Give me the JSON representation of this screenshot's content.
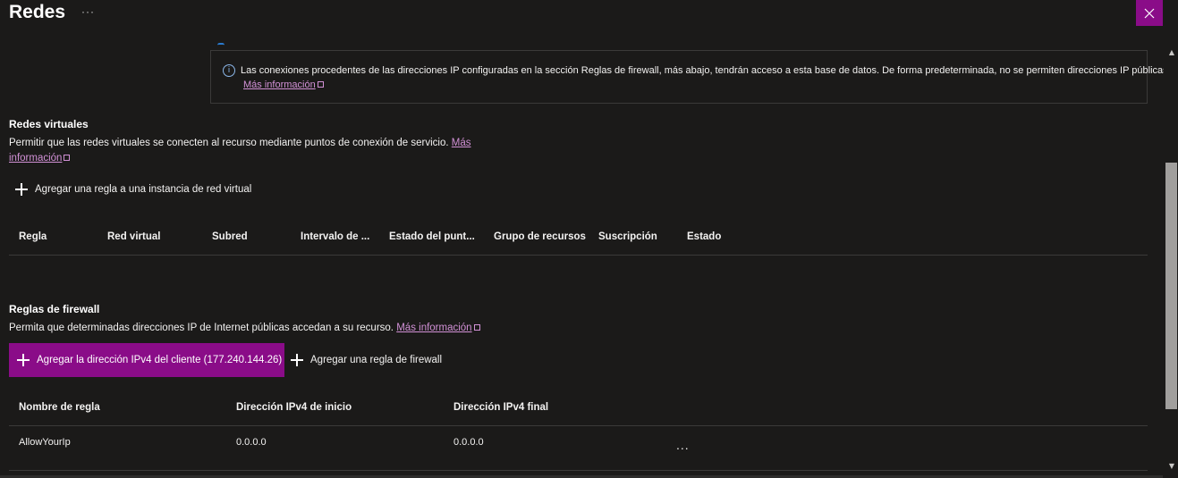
{
  "header": {
    "title": "Redes",
    "more": "···"
  },
  "info": {
    "icon": "info-icon",
    "text": "Las conexiones procedentes de las direcciones IP configuradas en la sección Reglas de firewall, más abajo, tendrán acceso a esta base de datos. De forma predeterminada, no se permiten direcciones IP públicas.",
    "link": "Más información"
  },
  "virtual_networks": {
    "heading": "Redes virtuales",
    "description": "Permitir que las redes virtuales se conecten al recurso mediante puntos de conexión de servicio.",
    "link_part1": "Más",
    "link_part2": "información",
    "add_rule": "Agregar una regla a una instancia de red virtual",
    "columns": [
      "Regla",
      "Red virtual",
      "Subred",
      "Intervalo de ...",
      "Estado del punt...",
      "Grupo de recursos",
      "Suscripción",
      "Estado"
    ]
  },
  "firewall": {
    "heading": "Reglas de firewall",
    "description": "Permita que determinadas direcciones IP de Internet públicas accedan a su recurso.",
    "link": "Más información",
    "add_client_ip": "Agregar la dirección IPv4 del cliente (177.240.144.26)",
    "add_rule": "Agregar una regla de firewall",
    "columns": [
      "Nombre de regla",
      "Dirección IPv4 de inicio",
      "Dirección IPv4 final"
    ],
    "rows": [
      {
        "name": "AllowYourIp",
        "start": "0.0.0.0",
        "end": "0.0.0.0",
        "more": "..."
      }
    ]
  },
  "colors": {
    "accent": "#8a0c88",
    "link": "#d291d6",
    "background": "#1b1a19"
  }
}
